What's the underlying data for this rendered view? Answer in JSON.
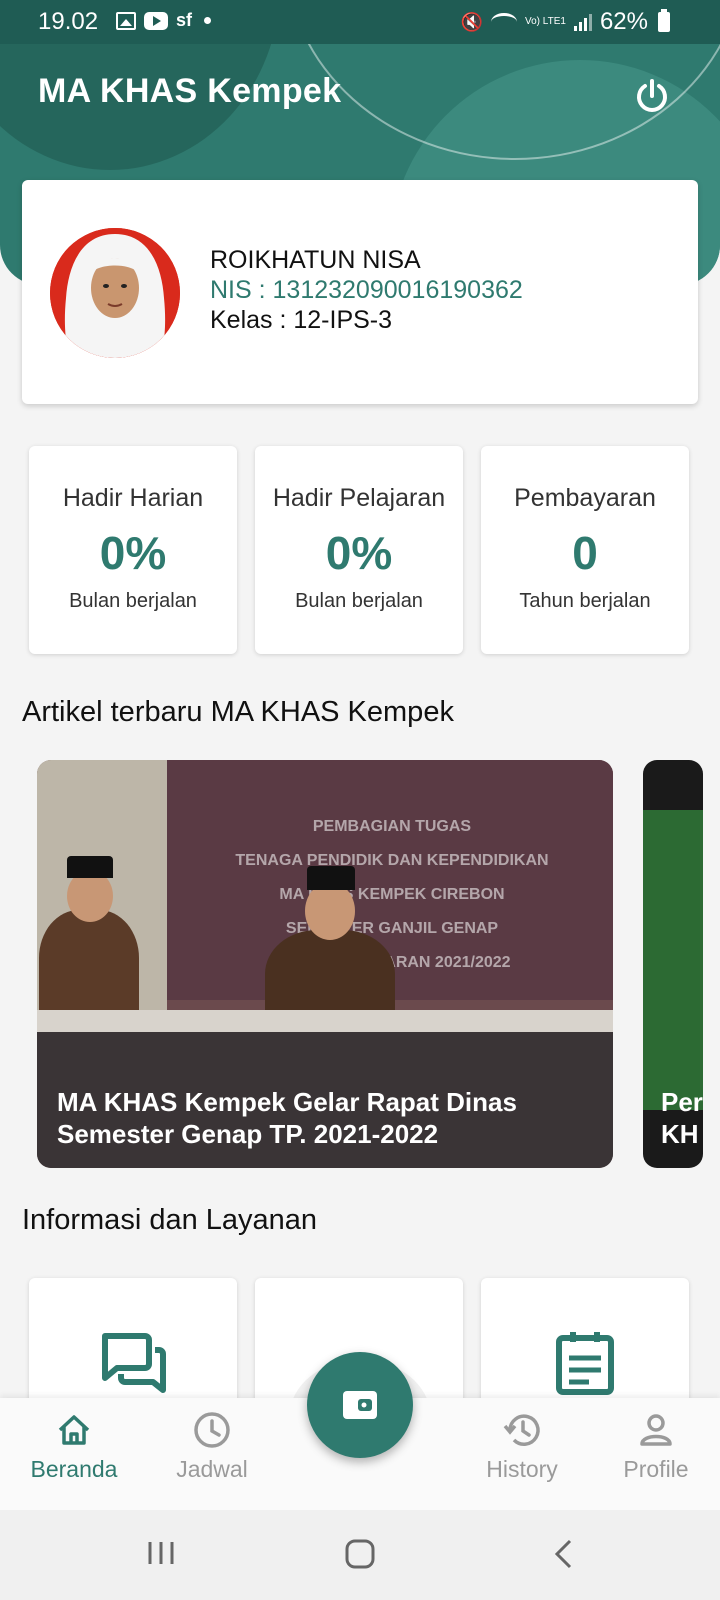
{
  "status_bar": {
    "time": "19.02",
    "battery": "62%",
    "icons": [
      "image-icon",
      "youtube-icon",
      "sf-icon",
      "dot-icon",
      "mute-icon",
      "wifi-icon",
      "volte-icon",
      "signal-icon",
      "battery-icon"
    ],
    "sf_label": "sf",
    "volte_label": "Vo) LTE1"
  },
  "header": {
    "title": "MA KHAS Kempek",
    "power_icon": "power-icon"
  },
  "profile": {
    "name": "ROIKHATUN NISA",
    "nis": "NIS : 131232090016190362",
    "kelas": "Kelas : 12-IPS-3"
  },
  "stats": [
    {
      "title": "Hadir Harian",
      "value": "0%",
      "sub": "Bulan berjalan"
    },
    {
      "title": "Hadir Pelajaran",
      "value": "0%",
      "sub": "Bulan berjalan"
    },
    {
      "title": "Pembayaran",
      "value": "0",
      "sub": "Tahun berjalan"
    }
  ],
  "articles_section": {
    "title": "Artikel terbaru MA KHAS Kempek",
    "items": [
      {
        "caption": "MA KHAS Kempek Gelar Rapat Dinas Semester Genap TP. 2021-2022"
      },
      {
        "caption": "Per\nKH"
      }
    ],
    "banner_lines": [
      "PEMBAGIAN TUGAS",
      "TENAGA PENDIDIK DAN KEPENDIDIKAN",
      "MA KHAS KEMPEK CIREBON",
      "SEMESTER GANJIL GENAP",
      "TAHUN PELAJARAN 2021/2022"
    ]
  },
  "services_section": {
    "title": "Informasi dan Layanan",
    "icons": [
      "chat-icon",
      "wallet-icon",
      "notes-icon"
    ]
  },
  "bottom_nav": {
    "items": [
      {
        "label": "Beranda",
        "icon": "home-icon",
        "active": true
      },
      {
        "label": "Jadwal",
        "icon": "clock-icon",
        "active": false
      },
      {
        "label": "History",
        "icon": "history-icon",
        "active": false
      },
      {
        "label": "Profile",
        "icon": "person-icon",
        "active": false
      }
    ],
    "fab_icon": "wallet-icon"
  },
  "colors": {
    "primary": "#2f7a6f",
    "primary_dark": "#1f5c54",
    "inactive": "#9a9a9a",
    "background": "#f4f4f4"
  }
}
